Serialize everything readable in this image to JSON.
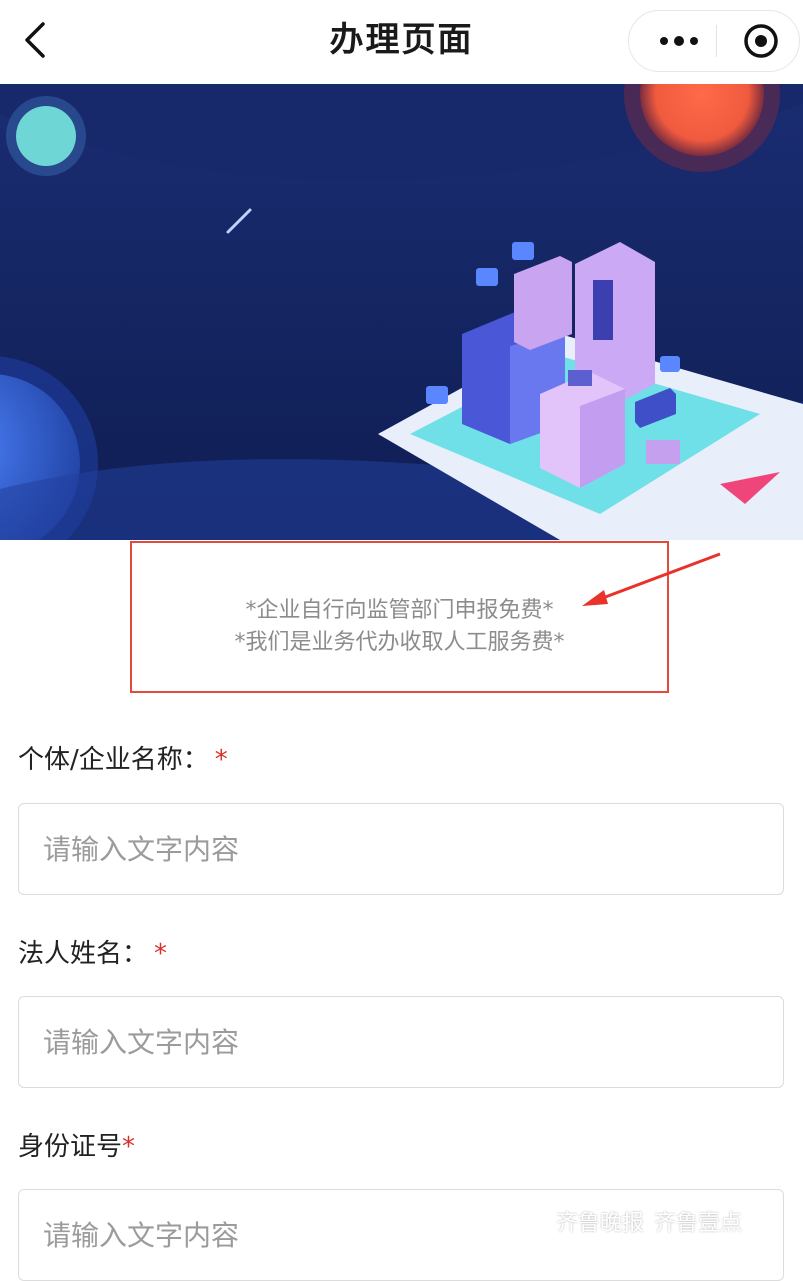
{
  "header": {
    "title": "办理页面",
    "back_icon": "chevron-left-icon",
    "more_icon": "more-dots-icon",
    "close_icon": "target-circle-icon"
  },
  "notice": {
    "line1": "*企业自行向监管部门申报免费*",
    "line2": "*我们是业务代办收取人工服务费*",
    "border_color": "#e24a3c"
  },
  "form": {
    "fields": [
      {
        "label": "个体/企业名称：",
        "required_mark": "*",
        "placeholder": "请输入文字内容"
      },
      {
        "label": "法人姓名：",
        "required_mark": "*",
        "placeholder": "请输入文字内容"
      },
      {
        "label": "身份证号",
        "required_mark": "*",
        "placeholder": "请输入文字内容"
      }
    ]
  },
  "watermark": {
    "text1": "齐鲁晚报",
    "text2": "齐鲁壹点"
  },
  "colors": {
    "banner_dark": "#13235e",
    "required": "#d9302c",
    "placeholder": "#9b9b9b"
  }
}
